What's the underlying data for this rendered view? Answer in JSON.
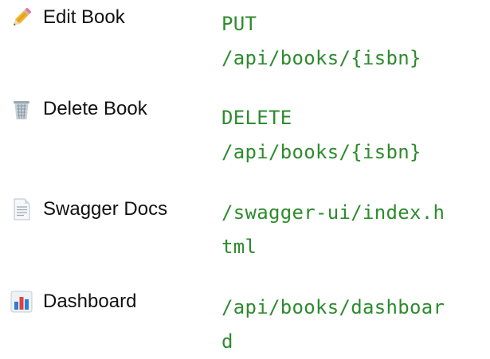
{
  "endpoints": [
    {
      "icon": "pencil-icon",
      "label": "Edit Book",
      "method": "PUT",
      "path": "/api/books/{isbn}"
    },
    {
      "icon": "wastebasket-icon",
      "label": "Delete Book",
      "method": "DELETE",
      "path": "/api/books/{isbn}"
    },
    {
      "icon": "document-icon",
      "label": "Swagger Docs",
      "path_line1": "/swagger-ui/index.h",
      "path_line2": "tml"
    },
    {
      "icon": "bar-chart-icon",
      "label": "Dashboard",
      "path_line1": "/api/books/dashboar",
      "path_line2": "d"
    }
  ]
}
